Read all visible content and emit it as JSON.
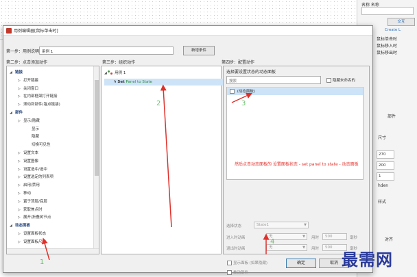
{
  "background": {
    "right_panel": {
      "name_label": "名称  名称",
      "blue_button": "交互",
      "create_link": "Create L",
      "event_items": [
        "鼠标单击时",
        "鼠标移入时",
        "鼠标移出时"
      ],
      "section_label": "尺寸",
      "fields": [
        "270",
        "200",
        "1"
      ],
      "side_labels": [
        "部件",
        "对齐",
        "hden",
        "样式"
      ]
    }
  },
  "dialog": {
    "title": "用例编辑器[鼠标单击时]",
    "step1_label": "第一步：用例说明",
    "case_name": "用例 1",
    "new_condition_button": "新增条件",
    "step2_title": "第二步：点击添加动作",
    "step3_title": "第三步：组织动作",
    "step4_title": "第四步：配置动作",
    "actions_tree": [
      {
        "label": "链接",
        "level": 0,
        "group": true
      },
      {
        "label": "打开链接",
        "level": 1
      },
      {
        "label": "关闭窗口",
        "level": 1
      },
      {
        "label": "在内部框架打开链接",
        "level": 1
      },
      {
        "label": "滚动到部件(锚点链接)",
        "level": 1
      },
      {
        "label": "部件",
        "level": 0,
        "group": true
      },
      {
        "label": "显示/隐藏",
        "level": 1
      },
      {
        "label": "显示",
        "level": 2
      },
      {
        "label": "隐藏",
        "level": 2
      },
      {
        "label": "切换可见性",
        "level": 2
      },
      {
        "label": "设置文本",
        "level": 1
      },
      {
        "label": "设置图像",
        "level": 1
      },
      {
        "label": "设置选中/选中",
        "level": 1
      },
      {
        "label": "设置选定的列表项",
        "level": 1
      },
      {
        "label": "启用/禁用",
        "level": 1
      },
      {
        "label": "移动",
        "level": 1
      },
      {
        "label": "置于顶层/底层",
        "level": 1
      },
      {
        "label": "获取焦点时",
        "level": 1
      },
      {
        "label": "展开/折叠树节点",
        "level": 1
      },
      {
        "label": "动态面板",
        "level": 0,
        "group": true
      },
      {
        "label": "设置面板状态",
        "level": 1
      },
      {
        "label": "设置面板尺寸",
        "level": 1
      }
    ],
    "organize": {
      "case_label": "用例 1",
      "action_set": "Set",
      "action_detail": "Panel to State"
    },
    "configure": {
      "select_label": "选择要设置状态的动态面板",
      "search_placeholder": "搜索",
      "hide_unnamed_label": "隐藏未命名的",
      "state_item": "(动态面板)",
      "red_note": "然后点击动态面板的  设置面板状态 - set panel to state - 动态面板",
      "select_state_label": "选择状态",
      "select_state_value": "State1",
      "enter_anim_label": "进入时动画",
      "exit_anim_label": "退出时动画",
      "anim_value": "无",
      "duration_label": "用时",
      "duration_value": "500",
      "ms_label": "毫秒",
      "show_panel_label": "显示面板 (如果隐藏)",
      "push_widgets_label": "推动部件"
    },
    "ok_button": "确定",
    "cancel_button": "取消"
  },
  "markers": [
    "1",
    "2",
    "3",
    "4"
  ],
  "watermark": "最需网",
  "colors": {
    "annotation_red": "#e0302a",
    "selection_blue": "#cde3f7",
    "marker_green": "#6cbf6c",
    "watermark_blue": "#2a3a9a"
  }
}
